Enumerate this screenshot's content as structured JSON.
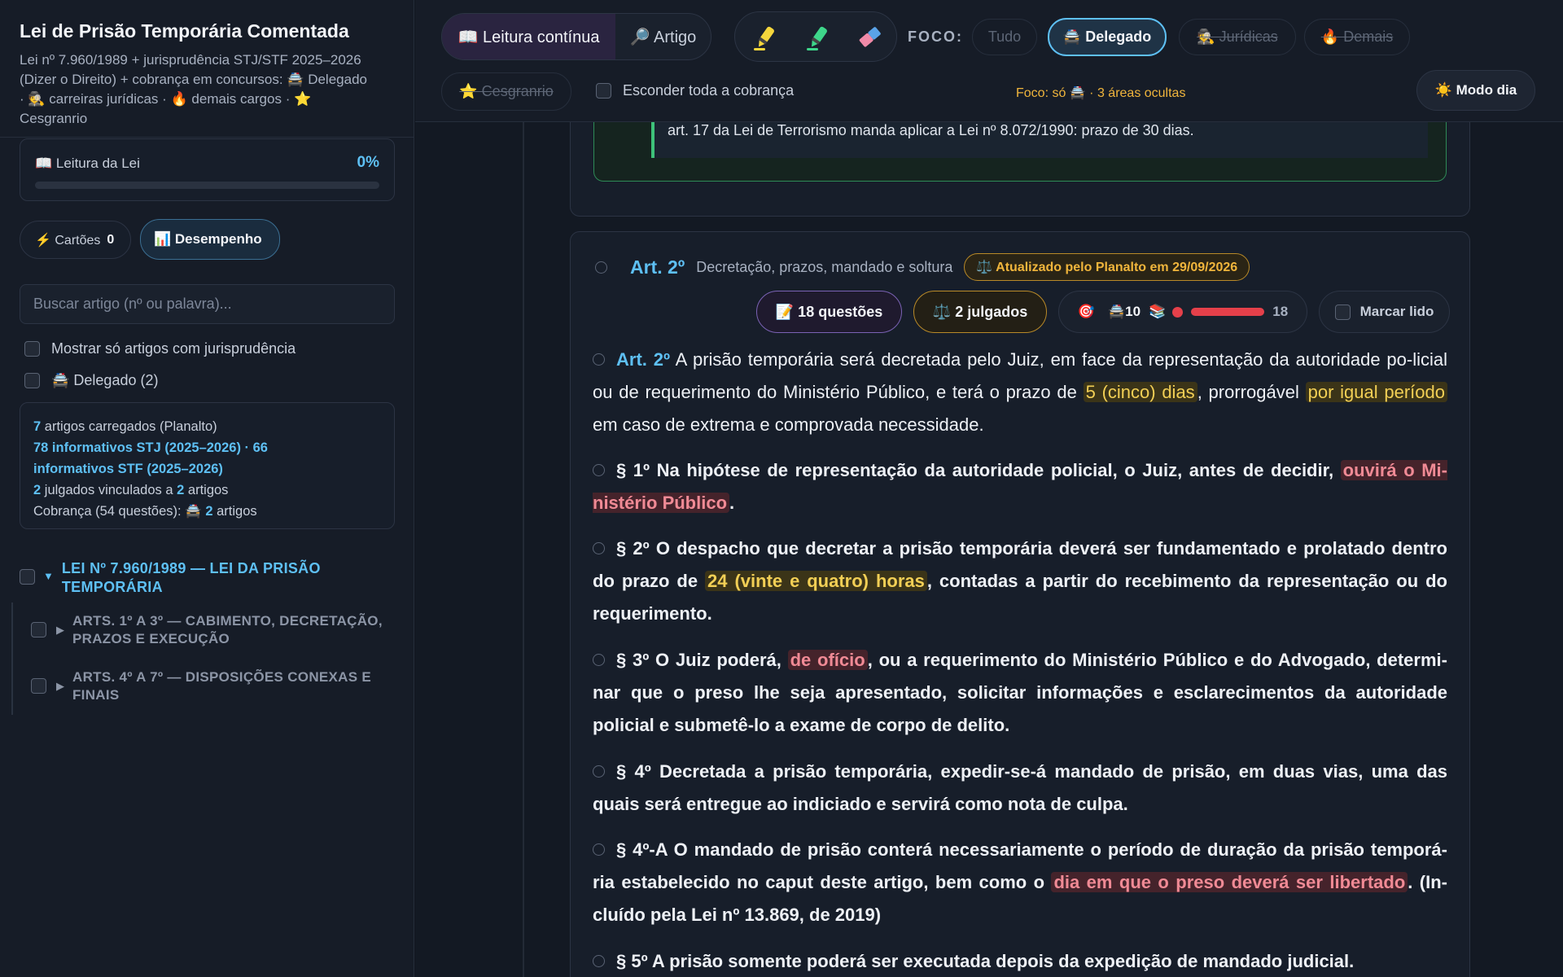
{
  "sidebar": {
    "title": "Lei de Prisão Temporária Comentada",
    "subtitle_l1": "Lei nº 7.960/1989 + jurisprudência STJ/STF 2025–2026",
    "subtitle_l2": "(Dizer o Direito) + cobrança em concursos: 🚔 Delegado",
    "subtitle_l3": "· 🕵 carreiras jurídicas · 🔥 demais cargos · ⭐",
    "subtitle_l4": "Cesgranrio",
    "progress_label": "📖 Leitura da Lei",
    "progress_value": "0%",
    "progress_fraction": 0,
    "cards_label": "⚡ Cartões",
    "cards_count": "0",
    "performance_label": "📊 Desempenho",
    "search_placeholder": "Buscar artigo (nº ou palavra)...",
    "filter_juris": "Mostrar só artigos com jurisprudência",
    "filter_delegado": "🚔 Delegado (2)",
    "stats": {
      "l1_num": "7",
      "l1_txt": " artigos carregados (Planalto)",
      "l2a": "78 informativos STJ (2025–2026) · 66",
      "l2b": "informativos STF (2025–2026)",
      "l3_n1": "2",
      "l3_txt1": " julgados vinculados a ",
      "l3_n2": "2",
      "l3_txt2": " artigos",
      "l4_txt": "Cobrança (54 questões): 🚔 ",
      "l4_n": "2",
      "l4_txt2": " artigos"
    },
    "tree": {
      "root_l1": "LEI Nº 7.960/1989 — LEI DA PRISÃO",
      "root_l2": "TEMPORÁRIA",
      "item1_l1": "ARTS. 1º A 3º — CABIMENTO, DECRETAÇÃO,",
      "item1_l2": "PRAZOS E EXECUÇÃO",
      "item2_l1": "ARTS. 4º A 7º — DISPOSIÇÕES CONEXAS E",
      "item2_l2": "FINAIS"
    }
  },
  "topbar": {
    "mode_continuous": "📖 Leitura contínua",
    "mode_article": "🔎 Artigo",
    "foco_label": "FOCO:",
    "chips": {
      "all": "Tudo",
      "delegado": "🚔 Delegado",
      "juridicas": "🕵 Jurídicas",
      "demais": "🔥 Demais",
      "cesgranrio": "⭐ Cesgranrio"
    },
    "hide_all": "Esconder toda a cobrança",
    "foco_info": "Foco: só 🚔 · 3 áreas ocultas",
    "day_mode": "☀️ Modo dia",
    "colors": {
      "accent": "#5ec0f4",
      "warning": "#f0b53c",
      "danger": "#e5404a"
    }
  },
  "main": {
    "prev_quote": "art. 17 da Lei de Terrorismo manda aplicar a Lei nº 8.072/1990: prazo de 30 dias.",
    "article": {
      "number": "Art. 2º",
      "description": "Decretação, prazos, mandado e soltura",
      "updated_badge": "⚖️ Atualizado pelo Planalto em 29/09/2026",
      "questions": "📝 18 questões",
      "judgments": "⚖️ 2 julgados",
      "stats_target": "🎯",
      "stats_delegado": "🚔10",
      "stats_books": "📚",
      "stats_total": "18",
      "stats_fill": 1,
      "mark_read": "Marcar lido",
      "caput": {
        "num": "Art. 2º",
        "t1": " A prisão temporária será decretada pelo Juiz, em face da representação da autoridade po-licial ou de requerimento do Ministério Público, e terá o prazo de ",
        "h1": "5 (cinco) dias",
        "t2": ", prorrogável ",
        "h2": "por igual período",
        "t3": " em caso de extrema e comprovada necessidade."
      },
      "p1": {
        "t1": "§ 1º Na hipótese de representação da autoridade policial, o Juiz, antes de decidir, ",
        "h1": "ouvirá o Mi-nistério Público",
        "t2": "."
      },
      "p2": {
        "t1": "§ 2º O despacho que decretar a prisão temporária deverá ser fundamentado e prolatado dentro do prazo de ",
        "h1": "24 (vinte e quatro) horas",
        "t2": ", contadas a partir do recebimento da representação ou do requerimento."
      },
      "p3": {
        "t1": "§ 3º O Juiz poderá, ",
        "h1": "de ofício",
        "t2": ", ou a requerimento do Ministério Público e do Advogado, determi-nar que o preso lhe seja apresentado, solicitar informações e esclarecimentos da autoridade policial e submetê-lo a exame de corpo de delito."
      },
      "p4": {
        "t1": "§ 4º Decretada a prisão temporária, expedir-se-á mandado de prisão, em duas vias, uma das quais será entregue ao indiciado e servirá como nota de culpa."
      },
      "p4a": {
        "t1": "§ 4º-A O mandado de prisão conterá necessariamente o período de duração da prisão temporá-ria estabelecido no caput deste artigo, bem como o ",
        "h1": "dia em que o preso deverá ser libertado",
        "t2": ". (In-cluído pela Lei nº 13.869, de 2019)"
      },
      "p5": {
        "t1": "§ 5º A prisão somente poderá ser executada depois da expedição de mandado judicial."
      }
    }
  }
}
